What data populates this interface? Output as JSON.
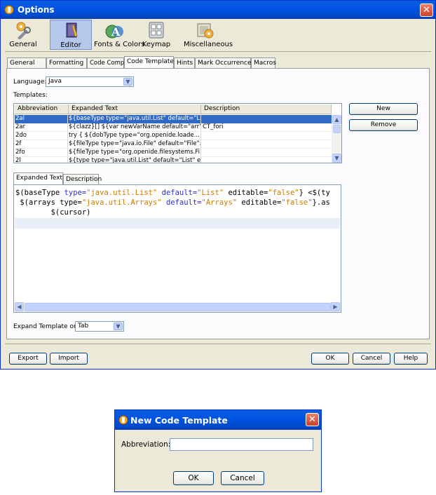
{
  "options": {
    "title": "Options",
    "categories": [
      {
        "label": "General",
        "icon": "general-wrench-icon"
      },
      {
        "label": "Editor",
        "icon": "editor-book-icon"
      },
      {
        "label": "Fonts & Colors",
        "icon": "fonts-colors-icon"
      },
      {
        "label": "Keymap",
        "icon": "keymap-icon"
      },
      {
        "label": "Miscellaneous",
        "icon": "miscellaneous-icon"
      }
    ],
    "selected_category": "Editor",
    "tabs": [
      "General",
      "Formatting",
      "Code Completion",
      "Code Templates",
      "Hints",
      "Mark Occurrences",
      "Macros"
    ],
    "active_tab": "Code Templates",
    "language_label": "Language:",
    "language_value": "Java",
    "templates_label": "Templates:",
    "table": {
      "headers": [
        "Abbreviation",
        "Expanded Text",
        "Description"
      ],
      "rows": [
        {
          "abbr": "2al",
          "expanded": "${baseType type=\"java.util.List\" default=\"Li...",
          "desc": ""
        },
        {
          "abbr": "2ar",
          "expanded": "${clazz}[] ${var newVarName default=\"arr\"...",
          "desc": "CT_fori"
        },
        {
          "abbr": "2do",
          "expanded": "try {   ${dobType type=\"org.openide.loade...",
          "desc": ""
        },
        {
          "abbr": "2f",
          "expanded": "${fileType type=\"java.io.File\" default=\"File\"...",
          "desc": ""
        },
        {
          "abbr": "2fo",
          "expanded": "${fileType type=\"org.openide.filesystems.Fi...",
          "desc": ""
        },
        {
          "abbr": "2l",
          "expanded": "${type type=\"java.util.List\" default=\"List\" e...",
          "desc": ""
        }
      ],
      "selected_index": 0
    },
    "new_button": "New",
    "remove_button": "Remove",
    "subtabs": [
      "Expanded Text",
      "Description"
    ],
    "active_subtab": "Expanded Text",
    "code_lines": [
      [
        {
          "t": "$(baseType ",
          "c": "kw"
        },
        {
          "t": "type=",
          "c": "at"
        },
        {
          "t": "\"java.util.List\" ",
          "c": "str"
        },
        {
          "t": "default=",
          "c": "at"
        },
        {
          "t": "\"List\" ",
          "c": "str"
        },
        {
          "t": "editable=",
          "c": "kw"
        },
        {
          "t": "\"false\"",
          "c": "str"
        },
        {
          "t": "} <$(ty",
          "c": "kw"
        }
      ],
      [
        {
          "t": " $(arrays ",
          "c": "kw"
        },
        {
          "t": "type=",
          "c": "kw"
        },
        {
          "t": "\"java.util.Arrays\" ",
          "c": "str"
        },
        {
          "t": "default=",
          "c": "at"
        },
        {
          "t": "\"Arrays\" ",
          "c": "str"
        },
        {
          "t": "editable=",
          "c": "kw"
        },
        {
          "t": "\"false\"",
          "c": "str"
        },
        {
          "t": "}.as",
          "c": "kw"
        }
      ],
      [
        {
          "t": "        $(cursor)",
          "c": "kw"
        }
      ]
    ],
    "expand_on_label": "Expand Template on:",
    "expand_on_value": "Tab",
    "export_button": "Export",
    "import_button": "Import",
    "ok_button": "OK",
    "cancel_button": "Cancel",
    "help_button": "Help"
  },
  "dialog": {
    "title": "New Code Template",
    "abbreviation_label": "Abbreviation:",
    "abbreviation_value": "",
    "ok_button": "OK",
    "cancel_button": "Cancel"
  },
  "colors": {
    "titlebar": "#0054e3",
    "selection": "#316ac5",
    "window_bg": "#ece9d8",
    "code_attr": "#2b2bd6",
    "code_string": "#ce7b00"
  }
}
